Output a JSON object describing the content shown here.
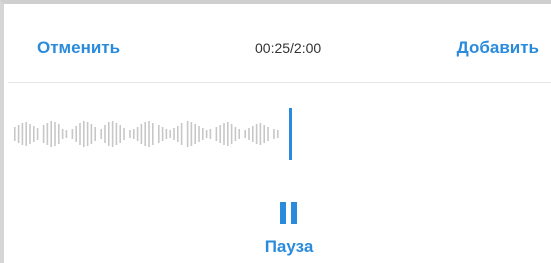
{
  "header": {
    "cancel_label": "Отменить",
    "timer": "00:25/2:00",
    "add_label": "Добавить"
  },
  "recorder": {
    "pause_label": "Пауза",
    "accent_color": "#2a8bdc",
    "wave_color": "#c7c7c7"
  }
}
